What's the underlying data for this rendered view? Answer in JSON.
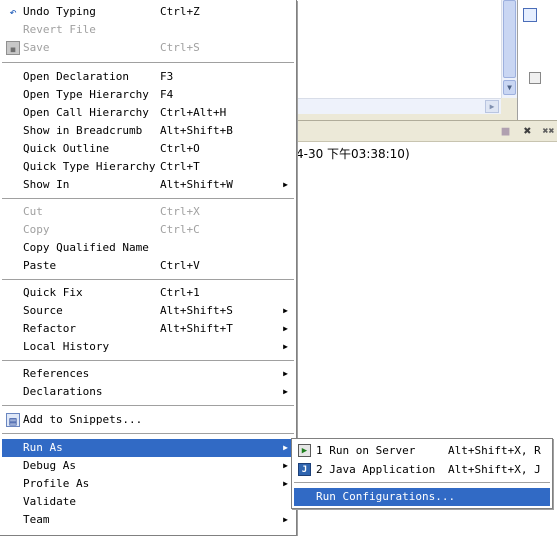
{
  "background": {
    "console_text": "4-30 下午03:38:10)"
  },
  "context_menu": {
    "items": [
      {
        "label": "Undo Typing",
        "accel": "Ctrl+Z",
        "icon": "undo-icon",
        "enabled": true
      },
      {
        "label": "Revert File",
        "accel": "",
        "enabled": false
      },
      {
        "label": "Save",
        "accel": "Ctrl+S",
        "icon": "save-icon",
        "enabled": false
      },
      {
        "label": "Open Declaration",
        "accel": "F3",
        "enabled": true
      },
      {
        "label": "Open Type Hierarchy",
        "accel": "F4",
        "enabled": true
      },
      {
        "label": "Open Call Hierarchy",
        "accel": "Ctrl+Alt+H",
        "enabled": true
      },
      {
        "label": "Show in Breadcrumb",
        "accel": "Alt+Shift+B",
        "enabled": true
      },
      {
        "label": "Quick Outline",
        "accel": "Ctrl+O",
        "enabled": true
      },
      {
        "label": "Quick Type Hierarchy",
        "accel": "Ctrl+T",
        "enabled": true
      },
      {
        "label": "Show In",
        "accel": "Alt+Shift+W",
        "submenu": true,
        "enabled": true
      },
      {
        "label": "Cut",
        "accel": "Ctrl+X",
        "enabled": false
      },
      {
        "label": "Copy",
        "accel": "Ctrl+C",
        "enabled": false
      },
      {
        "label": "Copy Qualified Name",
        "accel": "",
        "enabled": true
      },
      {
        "label": "Paste",
        "accel": "Ctrl+V",
        "enabled": true
      },
      {
        "label": "Quick Fix",
        "accel": "Ctrl+1",
        "enabled": true
      },
      {
        "label": "Source",
        "accel": "Alt+Shift+S",
        "submenu": true,
        "enabled": true
      },
      {
        "label": "Refactor",
        "accel": "Alt+Shift+T",
        "submenu": true,
        "enabled": true
      },
      {
        "label": "Local History",
        "accel": "",
        "submenu": true,
        "enabled": true
      },
      {
        "label": "References",
        "accel": "",
        "submenu": true,
        "enabled": true
      },
      {
        "label": "Declarations",
        "accel": "",
        "submenu": true,
        "enabled": true
      },
      {
        "label": "Add to Snippets...",
        "accel": "",
        "icon": "snippet-icon",
        "enabled": true
      },
      {
        "label": "Run As",
        "accel": "",
        "submenu": true,
        "enabled": true,
        "selected": true
      },
      {
        "label": "Debug As",
        "accel": "",
        "submenu": true,
        "enabled": true
      },
      {
        "label": "Profile As",
        "accel": "",
        "submenu": true,
        "enabled": true
      },
      {
        "label": "Validate",
        "accel": "",
        "enabled": true
      },
      {
        "label": "Team",
        "accel": "",
        "submenu": true,
        "enabled": true
      }
    ]
  },
  "run_as_submenu": {
    "items": [
      {
        "label": "1 Run on Server",
        "accel": "Alt+Shift+X, R",
        "icon": "server-icon"
      },
      {
        "label": "2 Java Application",
        "accel": "Alt+Shift+X, J",
        "icon": "java-app-icon"
      },
      {
        "label": "Run Configurations...",
        "accel": "",
        "selected": true
      }
    ]
  },
  "icons": {
    "submenu_arrow": "▶",
    "undo": "↶",
    "save": "▪",
    "snippet": "▤",
    "server": "▶",
    "java_app": "J",
    "close": "✖",
    "stop": "■",
    "remove_all": "✖✖"
  },
  "colors": {
    "selection": "#316ac5",
    "disabled_text": "#a0a0a0",
    "menu_bg": "#ffffff",
    "chrome_bg": "#ece9d8"
  }
}
